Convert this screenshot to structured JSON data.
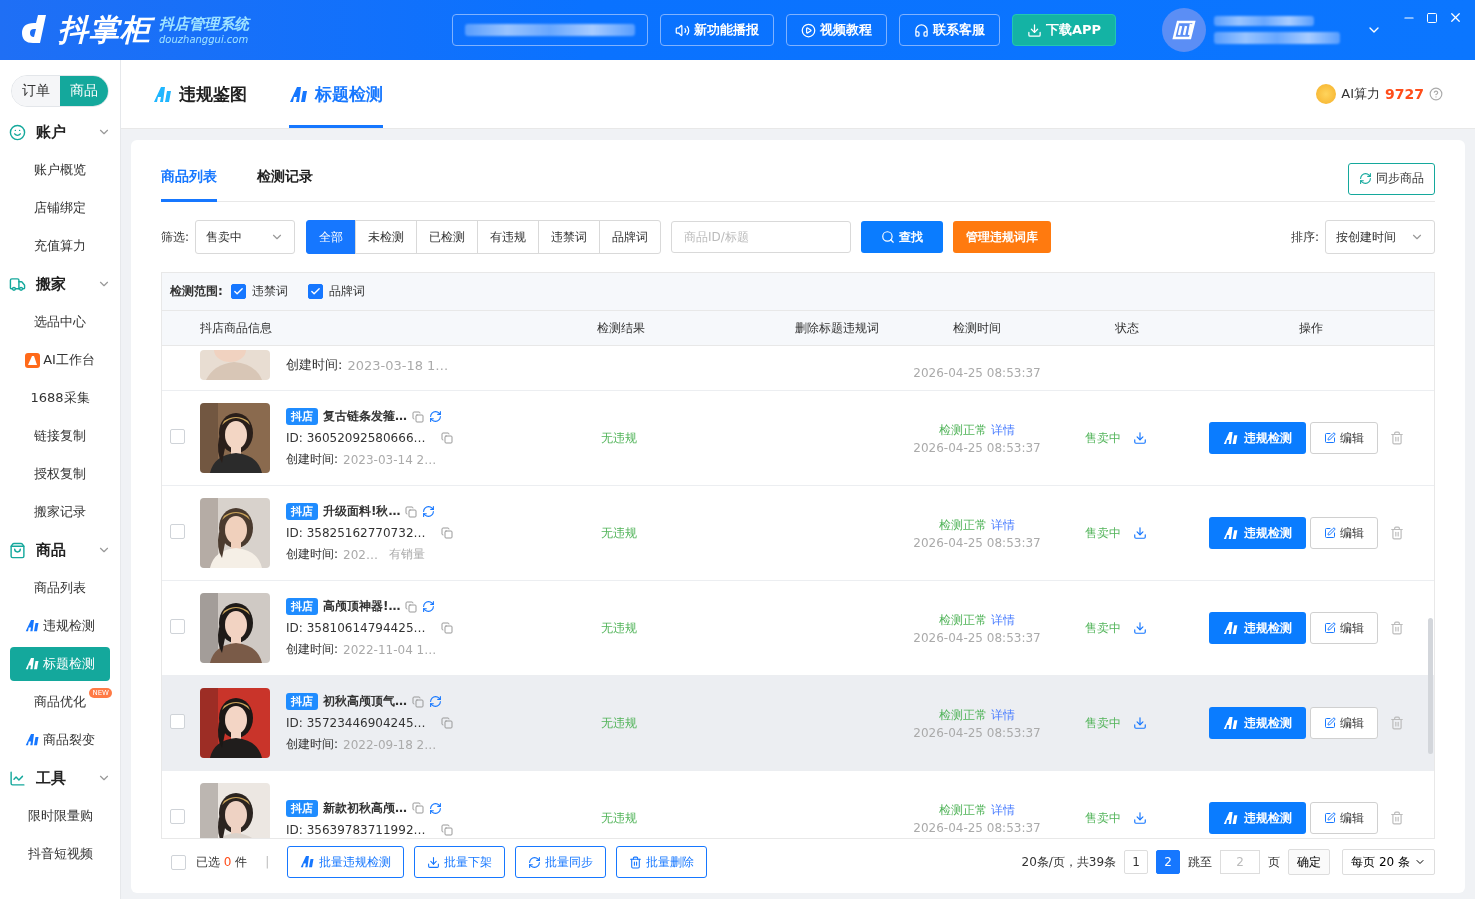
{
  "header": {
    "logo": {
      "name": "抖掌柜",
      "subtitle": "抖店管理系统",
      "domain": "douzhanggui.com"
    },
    "buttons": [
      {
        "label": "新功能播报",
        "kind": "speaker",
        "primary": false
      },
      {
        "label": "视频教程",
        "kind": "video",
        "primary": false
      },
      {
        "label": "联系客服",
        "kind": "headset",
        "primary": false
      },
      {
        "label": "下载APP",
        "kind": "download",
        "primary": true
      }
    ]
  },
  "sidebar": {
    "modes": [
      {
        "label": "订单",
        "selected": false
      },
      {
        "label": "商品",
        "selected": true
      }
    ],
    "groups": [
      {
        "title": "账户",
        "kind": "account",
        "expanded": true,
        "items": [
          {
            "label": "账户概览",
            "kind": "plain",
            "selected": false
          },
          {
            "label": "店铺绑定",
            "kind": "plain",
            "selected": false
          },
          {
            "label": "充值算力",
            "kind": "plain",
            "selected": false
          }
        ]
      },
      {
        "title": "搬家",
        "kind": "move",
        "expanded": true,
        "items": [
          {
            "label": "选品中心",
            "kind": "plain",
            "selected": false
          },
          {
            "label": "AI工作台",
            "kind": "app",
            "selected": false
          },
          {
            "label": "1688采集",
            "kind": "plain",
            "selected": false
          },
          {
            "label": "链接复制",
            "kind": "plain",
            "selected": false
          },
          {
            "label": "授权复制",
            "kind": "plain",
            "selected": false
          },
          {
            "label": "搬家记录",
            "kind": "plain",
            "selected": false
          }
        ]
      },
      {
        "title": "商品",
        "kind": "goods",
        "expanded": true,
        "items": [
          {
            "label": "商品列表",
            "kind": "plain",
            "selected": false
          },
          {
            "label": "违规检测",
            "kind": "ai",
            "selected": false
          },
          {
            "label": "标题检测",
            "kind": "ai",
            "selected": true
          },
          {
            "label": "商品优化",
            "kind": "plain",
            "selected": false,
            "badge": "NEW"
          },
          {
            "label": "商品裂变",
            "kind": "ai",
            "selected": false
          }
        ]
      },
      {
        "title": "工具",
        "kind": "tools",
        "expanded": true,
        "items": [
          {
            "label": "限时限量购",
            "kind": "plain",
            "selected": false
          },
          {
            "label": "抖音短视频",
            "kind": "plain",
            "selected": false
          }
        ]
      }
    ]
  },
  "top_tabs": [
    {
      "label": "违规鉴图",
      "selected": false
    },
    {
      "label": "标题检测",
      "selected": true
    }
  ],
  "ai_power": {
    "label": "AI算力",
    "value": "9727"
  },
  "card_tabs": [
    {
      "label": "商品列表",
      "selected": true
    },
    {
      "label": "检测记录",
      "selected": false
    }
  ],
  "sync_button": "同步商品",
  "filter": {
    "label": "筛选:",
    "select": "售卖中",
    "segments": [
      {
        "label": "全部",
        "selected": true
      },
      {
        "label": "未检测",
        "selected": false
      },
      {
        "label": "已检测",
        "selected": false
      },
      {
        "label": "有违规",
        "selected": false
      },
      {
        "label": "违禁词",
        "selected": false
      },
      {
        "label": "品牌词",
        "selected": false
      }
    ],
    "search_placeholder": "商品ID/标题",
    "search_button": "查找",
    "manage_button": "管理违规词库",
    "sort_label": "排序:",
    "sort_select": "按创建时间"
  },
  "scope": {
    "label": "检测范围:",
    "options": [
      {
        "label": "违禁词",
        "checked": true
      },
      {
        "label": "品牌词",
        "checked": true
      }
    ]
  },
  "table": {
    "columns": [
      "抖店商品信息",
      "检测结果",
      "删除标题违规词",
      "检测时间",
      "状态",
      "操作"
    ],
    "rows": [
      {
        "kind": "partial",
        "created_label": "创建时间:",
        "created": "2023-03-18 1…",
        "check_time": "2026-04-25 08:53:37"
      },
      {
        "kind": "full",
        "checked": false,
        "highlighted": false,
        "shop": "抖店",
        "title": "复古链条发箍…",
        "id": "ID: 36052092580666…",
        "created_label": "创建时间:",
        "created": "2023-03-14 2…",
        "result": "无违规",
        "check_status": "检测正常",
        "detail": "详情",
        "check_time": "2026-04-25 08:53:37",
        "status": "售卖中",
        "action": "违规检测",
        "edit": "编辑"
      },
      {
        "kind": "full",
        "checked": false,
        "highlighted": false,
        "shop": "抖店",
        "title": "升级面料!秋…",
        "id": "ID: 35825162770732…",
        "created_label": "创建时间:",
        "created": "202…",
        "sales": "有销量",
        "result": "无违规",
        "check_status": "检测正常",
        "detail": "详情",
        "check_time": "2026-04-25 08:53:37",
        "status": "售卖中",
        "action": "违规检测",
        "edit": "编辑"
      },
      {
        "kind": "full",
        "checked": false,
        "highlighted": false,
        "shop": "抖店",
        "title": "高颅顶神器!…",
        "id": "ID: 35810614794425…",
        "created_label": "创建时间:",
        "created": "2022-11-04 1…",
        "result": "无违规",
        "check_status": "检测正常",
        "detail": "详情",
        "check_time": "2026-04-25 08:53:37",
        "status": "售卖中",
        "action": "违规检测",
        "edit": "编辑"
      },
      {
        "kind": "full",
        "checked": false,
        "highlighted": true,
        "shop": "抖店",
        "title": "初秋高颅顶气…",
        "id": "ID: 35723446904245…",
        "created_label": "创建时间:",
        "created": "2022-09-18 2…",
        "result": "无违规",
        "check_status": "检测正常",
        "detail": "详情",
        "check_time": "2026-04-25 08:53:37",
        "status": "售卖中",
        "action": "违规检测",
        "edit": "编辑"
      },
      {
        "kind": "full",
        "checked": false,
        "highlighted": false,
        "shop": "抖店",
        "title": "新款初秋高颅…",
        "id": "ID: 35639783711992…",
        "result": "无违规",
        "check_status": "检测正常",
        "detail": "详情",
        "check_time": "2026-04-25 08:53:37",
        "status": "售卖中",
        "action": "违规检测",
        "edit": "编辑"
      }
    ]
  },
  "footer": {
    "select_all_checked": false,
    "selected_label": "已选",
    "selected_count": "0",
    "selected_unit": "件",
    "separator": "|",
    "batch": [
      {
        "label": "批量违规检测",
        "kind": "ai"
      },
      {
        "label": "批量下架",
        "kind": "download"
      },
      {
        "label": "批量同步",
        "kind": "sync"
      },
      {
        "label": "批量删除",
        "kind": "trash"
      }
    ],
    "summary": "20条/页，共39条",
    "pages": [
      {
        "label": "1",
        "selected": false
      },
      {
        "label": "2",
        "selected": true
      }
    ],
    "jump_label": "跳至",
    "jump_placeholder": "2",
    "page_unit": "页",
    "confirm": "确定",
    "page_size": "每页 20 条"
  }
}
